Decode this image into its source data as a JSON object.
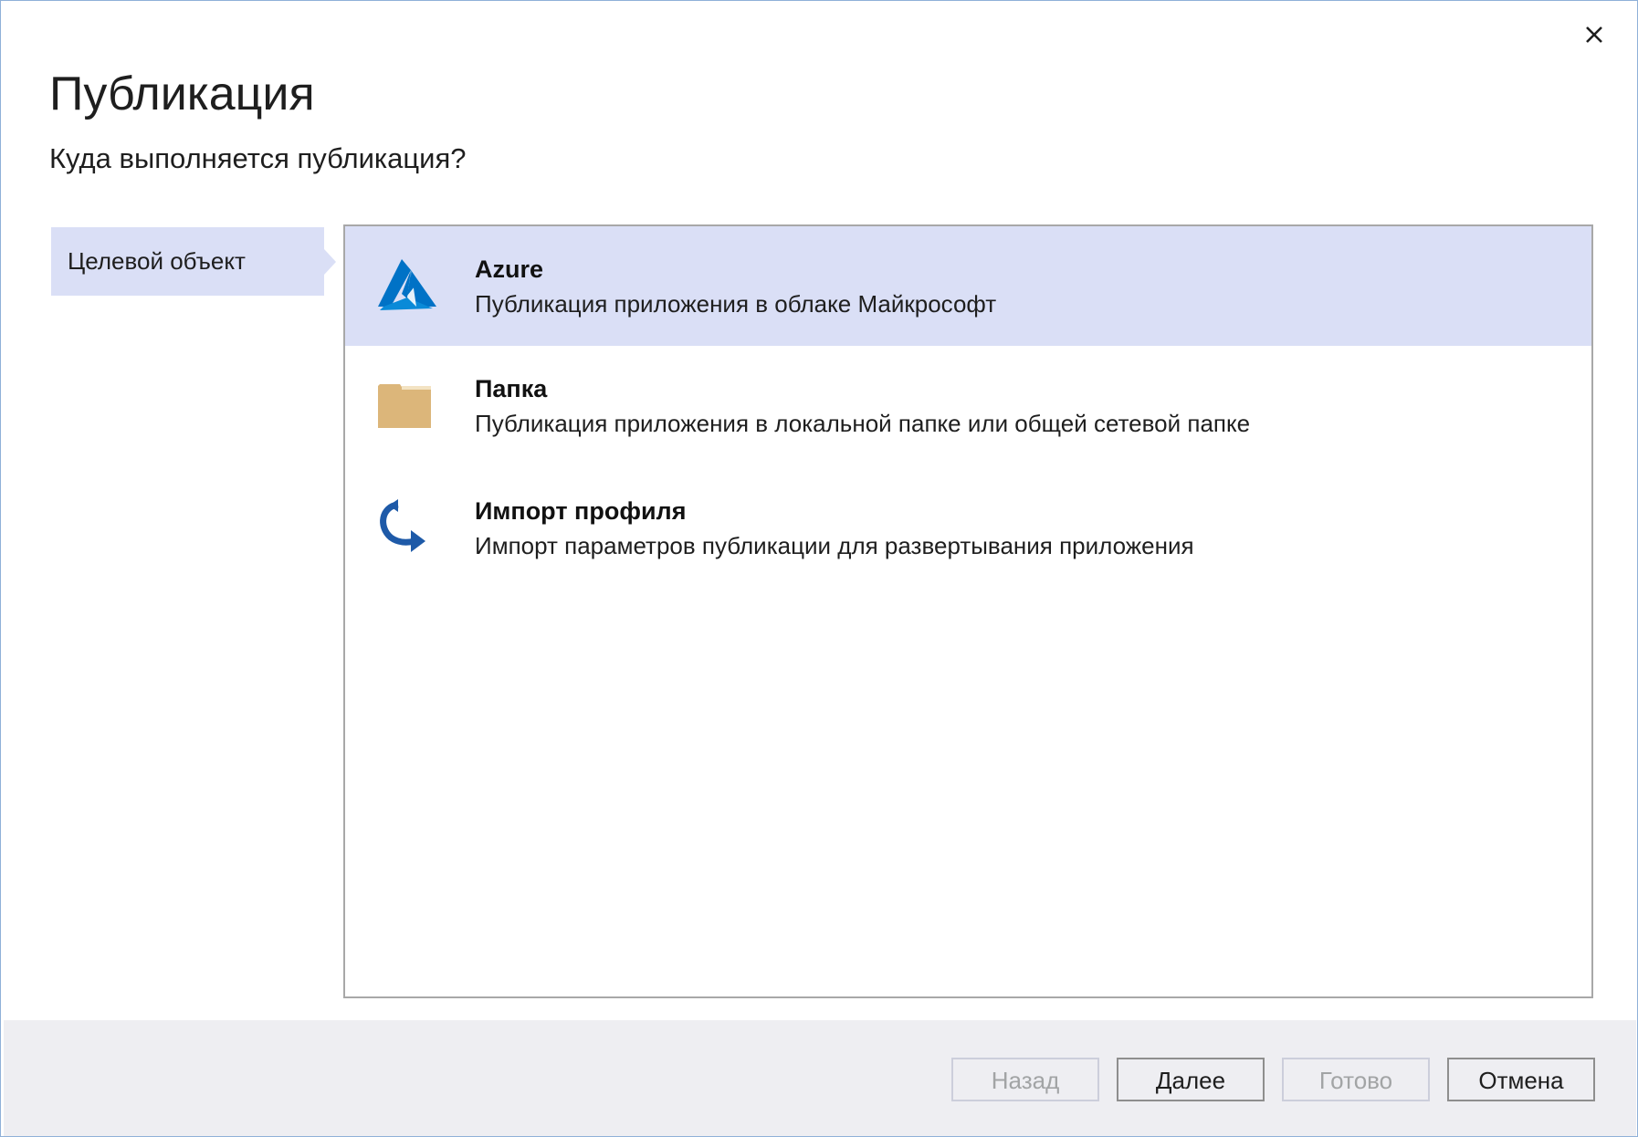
{
  "dialog": {
    "title": "Публикация",
    "subtitle": "Куда выполняется публикация?"
  },
  "sidebar": {
    "items": [
      {
        "label": "Целевой объект",
        "selected": true
      }
    ]
  },
  "targets": [
    {
      "title": "Azure",
      "description": "Публикация приложения в облаке Майкрософт",
      "icon": "azure-logo-icon",
      "selected": true
    },
    {
      "title": "Папка",
      "description": "Публикация приложения в локальной папке или общей сетевой папке",
      "icon": "folder-icon",
      "selected": false
    },
    {
      "title": "Импорт профиля",
      "description": "Импорт параметров публикации для развертывания приложения",
      "icon": "import-arrow-icon",
      "selected": false
    }
  ],
  "buttons": {
    "back": {
      "label": "Назад",
      "enabled": false
    },
    "next": {
      "label": "Далее",
      "enabled": true
    },
    "finish": {
      "label": "Готово",
      "enabled": false
    },
    "cancel": {
      "label": "Отмена",
      "enabled": true
    }
  },
  "colors": {
    "selection": "#dadff6",
    "footer": "#eeeef2",
    "azure_blue": "#0072c6",
    "folder": "#dcb67a",
    "import_blue": "#1e5aa8"
  }
}
